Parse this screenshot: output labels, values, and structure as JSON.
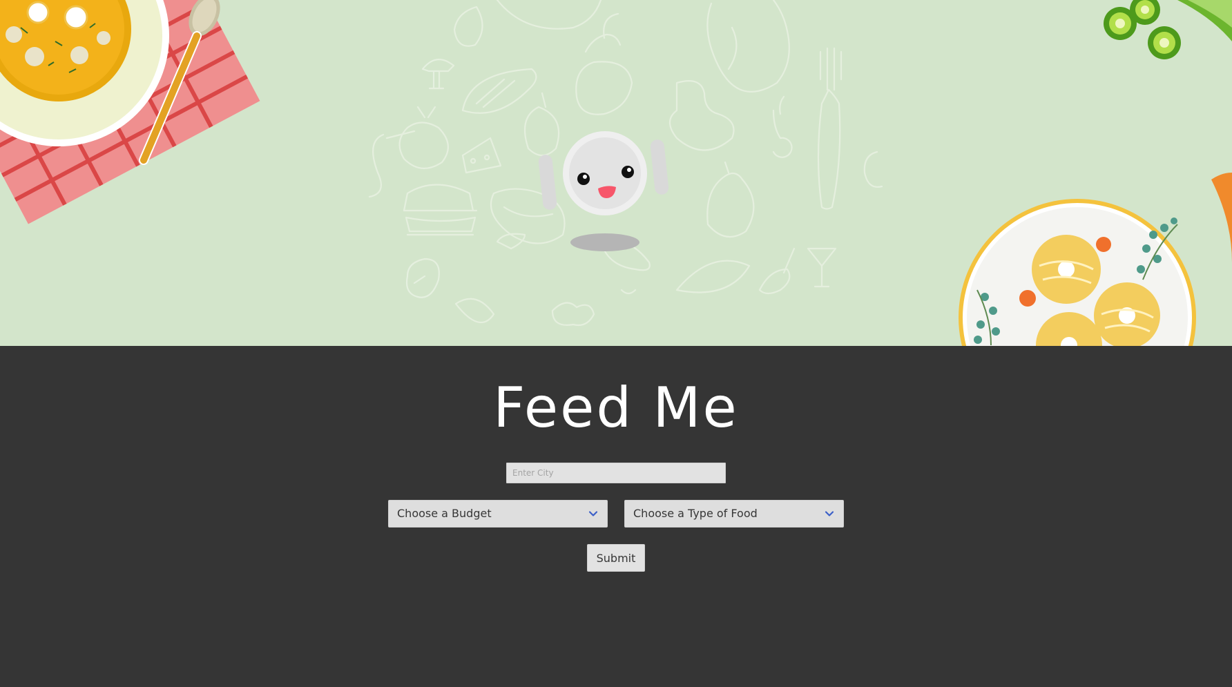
{
  "app": {
    "title": "Feed Me"
  },
  "form": {
    "city_placeholder": "Enter City",
    "city_value": "",
    "budget_selected": "Choose a Budget",
    "food_selected": "Choose a Type of Food",
    "submit_label": "Submit"
  },
  "colors": {
    "hero_background": "#d3e5cb",
    "page_background": "#353535",
    "title_text": "#ffffff",
    "chevron": "#3b5fc8"
  },
  "hero": {
    "illustrations": [
      "soup-bowl",
      "spoon",
      "checkered-napkin",
      "okra-slices",
      "donut-plate",
      "robot-mascot",
      "doodle-vegetables"
    ]
  }
}
